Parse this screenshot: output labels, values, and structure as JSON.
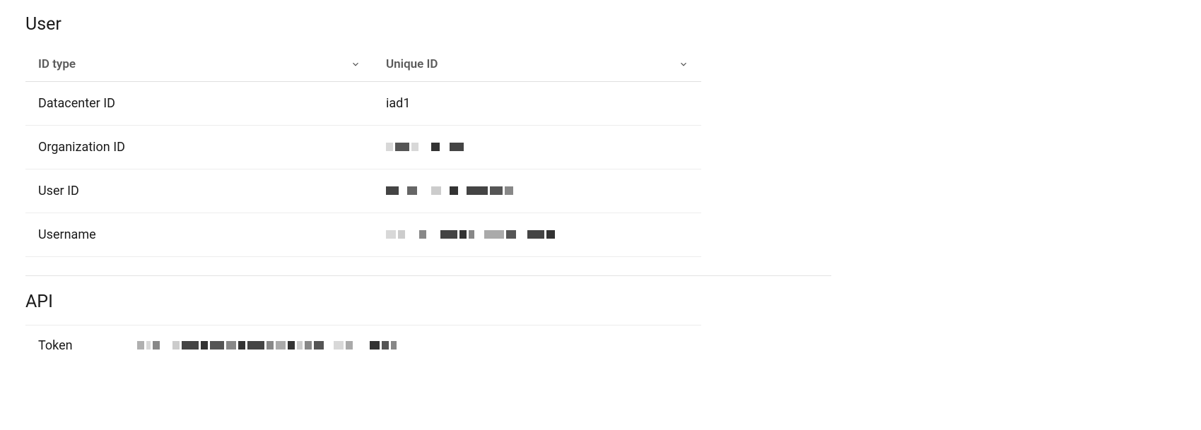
{
  "user_section": {
    "title": "User",
    "headers": {
      "id_type": "ID type",
      "unique_id": "Unique ID"
    },
    "rows": [
      {
        "type": "Datacenter ID",
        "value": "iad1",
        "redacted": false
      },
      {
        "type": "Organization ID",
        "value": "",
        "redacted": true
      },
      {
        "type": "User ID",
        "value": "",
        "redacted": true
      },
      {
        "type": "Username",
        "value": "",
        "redacted": true
      }
    ]
  },
  "api_section": {
    "title": "API",
    "rows": [
      {
        "label": "Token",
        "value": "",
        "redacted": true
      }
    ]
  }
}
